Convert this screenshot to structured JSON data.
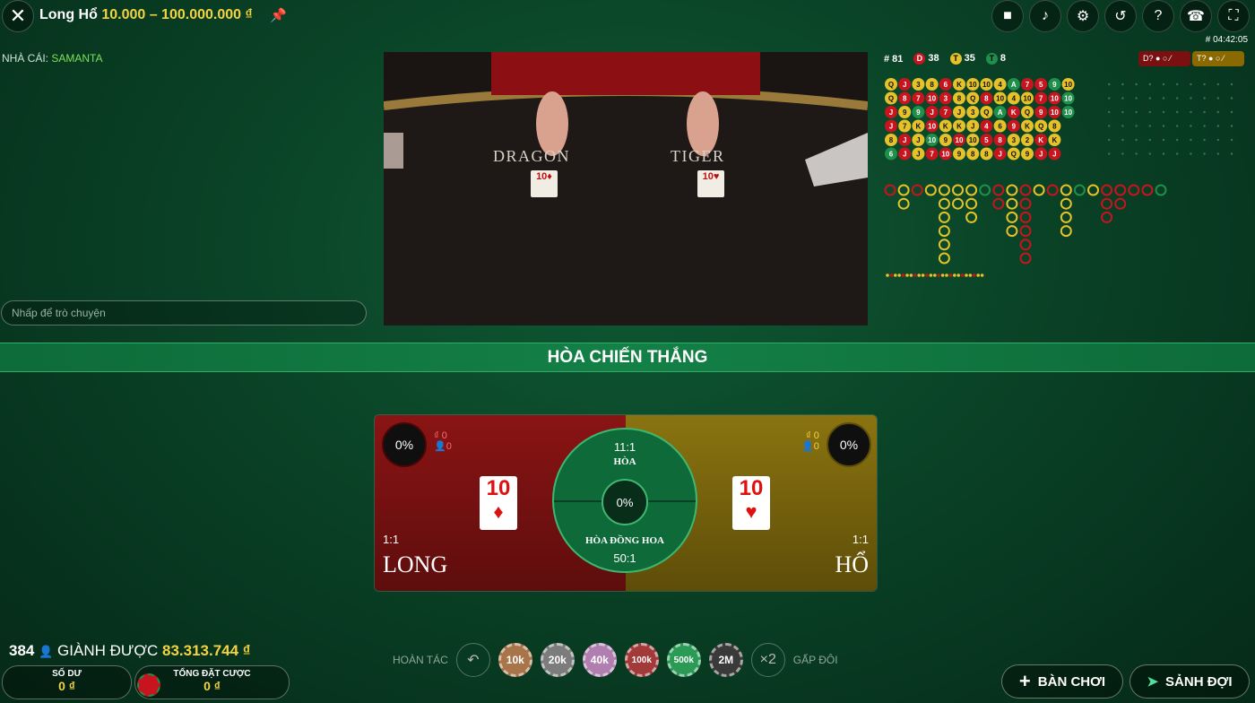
{
  "header": {
    "game": "Long Hổ",
    "limits": "10.000 – 100.000.000 ₫",
    "time": "# 04:42:05"
  },
  "dealer": {
    "label": "NHÀ CÁI:",
    "name": "SAMANTA"
  },
  "chat": {
    "placeholder": "Nhấp để trò chuyện"
  },
  "video": {
    "dragon_label": "DRAGON",
    "tiger_label": "TIGER",
    "dragon_card": "10♦",
    "tiger_card": "10♥"
  },
  "stats": {
    "rounds": "# 81",
    "dragon_letter": "D",
    "dragon": "38",
    "tie_letter": "T",
    "tie": "35",
    "tiger_letter": "T",
    "tiger": "8",
    "dragon_predict": "D?",
    "tiger_predict": "T?"
  },
  "banner": "HÒA CHIẾN THẮNG",
  "bet": {
    "long": {
      "pct": "0%",
      "money": "₫ 0",
      "players": "0",
      "ratio": "1:1",
      "name": "LONG",
      "card_rank": "10",
      "card_suit": "♦"
    },
    "ho": {
      "pct": "0%",
      "money": "₫ 0",
      "players": "0",
      "ratio": "1:1",
      "name": "HỔ",
      "card_rank": "10",
      "card_suit": "♥"
    },
    "tie": {
      "ratio": "11:1",
      "name": "HÒA",
      "pct": "0%",
      "suited_name": "HÒA ĐỒNG HOA",
      "suited_ratio": "50:1"
    }
  },
  "footer": {
    "players": "384",
    "won_label": "GIÀNH ĐƯỢC",
    "won": "83.313.744 ₫",
    "balance_label": "SỐ DƯ",
    "balance": "0 ₫",
    "total_label": "TỔNG ĐẶT CƯỢC",
    "total": "0 ₫",
    "undo": "HOÀN TÁC",
    "double_label": "GẤP ĐÔI",
    "double": "×2",
    "chips": [
      "10k",
      "20k",
      "40k",
      "100k",
      "500k",
      "2M"
    ],
    "play_btn": "BÀN CHƠI",
    "lobby_btn": "SẢNH ĐỢI"
  },
  "colors": {
    "dragon": "#c8141e",
    "tiger": "#e6c22a",
    "tie": "#1f8f4a",
    "accent": "#f3d341"
  },
  "road": {
    "bead": [
      [
        "Q",
        "J",
        "3",
        "8",
        "6",
        "K",
        "10",
        "10",
        "4",
        "A",
        "7",
        "5",
        "9",
        "10"
      ],
      [
        "Q",
        "8",
        "7",
        "10",
        "3",
        "8",
        "Q",
        "8",
        "10",
        "4",
        "10",
        "7",
        "10",
        "10"
      ],
      [
        "J",
        "9",
        "9",
        "J",
        "7",
        "J",
        "3",
        "Q",
        "A",
        "K",
        "Q",
        "9",
        "10",
        "10"
      ],
      [
        "J",
        "7",
        "K",
        "10",
        "K",
        "K",
        "J",
        "4",
        "6",
        "9",
        "K",
        "Q",
        "8"
      ],
      [
        "8",
        "J",
        "J",
        "10",
        "9",
        "10",
        "10",
        "5",
        "8",
        "3",
        "2",
        "K",
        "K"
      ],
      [
        "6",
        "J",
        "J",
        "7",
        "10",
        "9",
        "8",
        "8",
        "J",
        "Q",
        "9",
        "J",
        "J"
      ]
    ],
    "bead_colors": [
      [
        "y",
        "r",
        "y",
        "y",
        "r",
        "y",
        "y",
        "y",
        "y",
        "g",
        "r",
        "r",
        "g",
        "y"
      ],
      [
        "y",
        "r",
        "r",
        "r",
        "r",
        "y",
        "y",
        "r",
        "y",
        "y",
        "y",
        "r",
        "r",
        "g"
      ],
      [
        "r",
        "y",
        "g",
        "r",
        "r",
        "y",
        "y",
        "y",
        "g",
        "r",
        "y",
        "r",
        "r",
        "g"
      ],
      [
        "r",
        "y",
        "y",
        "r",
        "y",
        "y",
        "y",
        "r",
        "y",
        "r",
        "y",
        "y",
        "y"
      ],
      [
        "y",
        "r",
        "y",
        "g",
        "y",
        "r",
        "y",
        "r",
        "r",
        "y",
        "y",
        "r",
        "y"
      ],
      [
        "g",
        "r",
        "y",
        "r",
        "r",
        "y",
        "y",
        "y",
        "r",
        "y",
        "y",
        "r",
        "r"
      ]
    ]
  }
}
